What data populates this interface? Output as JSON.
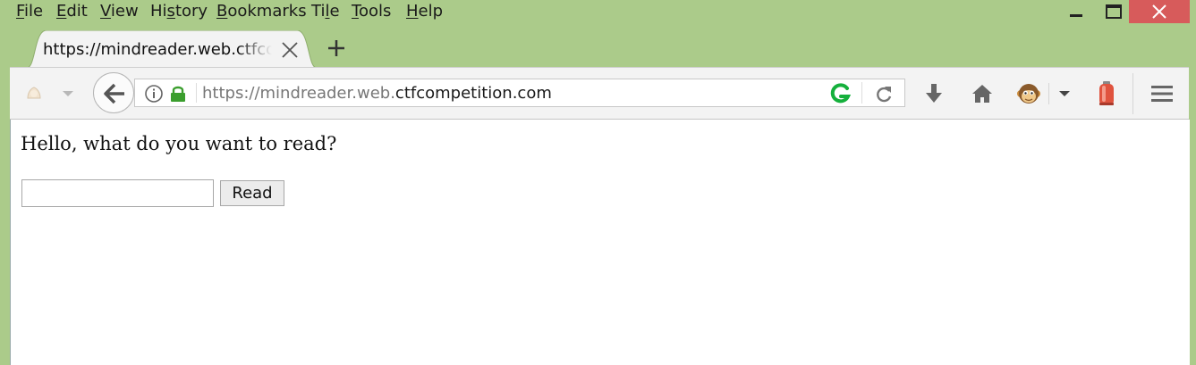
{
  "menu": {
    "file": "File",
    "edit": "Edit",
    "view": "View",
    "history": "History",
    "bookmarks": "Bookmarks",
    "tile": "Tile",
    "tools": "Tools",
    "help": "Help"
  },
  "tab": {
    "title": "https://mindreader.web.ctfcompetition.com"
  },
  "urlbar": {
    "prefix": "https://mindreader.web.",
    "host": "ctfcompetition.com"
  },
  "page": {
    "heading": "Hello, what do you want to read?",
    "input_value": "",
    "button_label": "Read"
  },
  "icons": {
    "back": "back-arrow-icon",
    "info": "info-icon",
    "lock": "lock-icon",
    "grammarly": "grammarly-icon",
    "reload": "reload-icon",
    "download": "download-icon",
    "home": "home-icon",
    "monkey": "greasemonkey-icon",
    "lantern": "lantern-icon",
    "menu": "hamburger-menu-icon"
  },
  "colors": {
    "titlebar": "#abcb8a",
    "close_button": "#d75b5b",
    "lock_green": "#3b9e2e",
    "grammarly_green": "#15b03c"
  }
}
